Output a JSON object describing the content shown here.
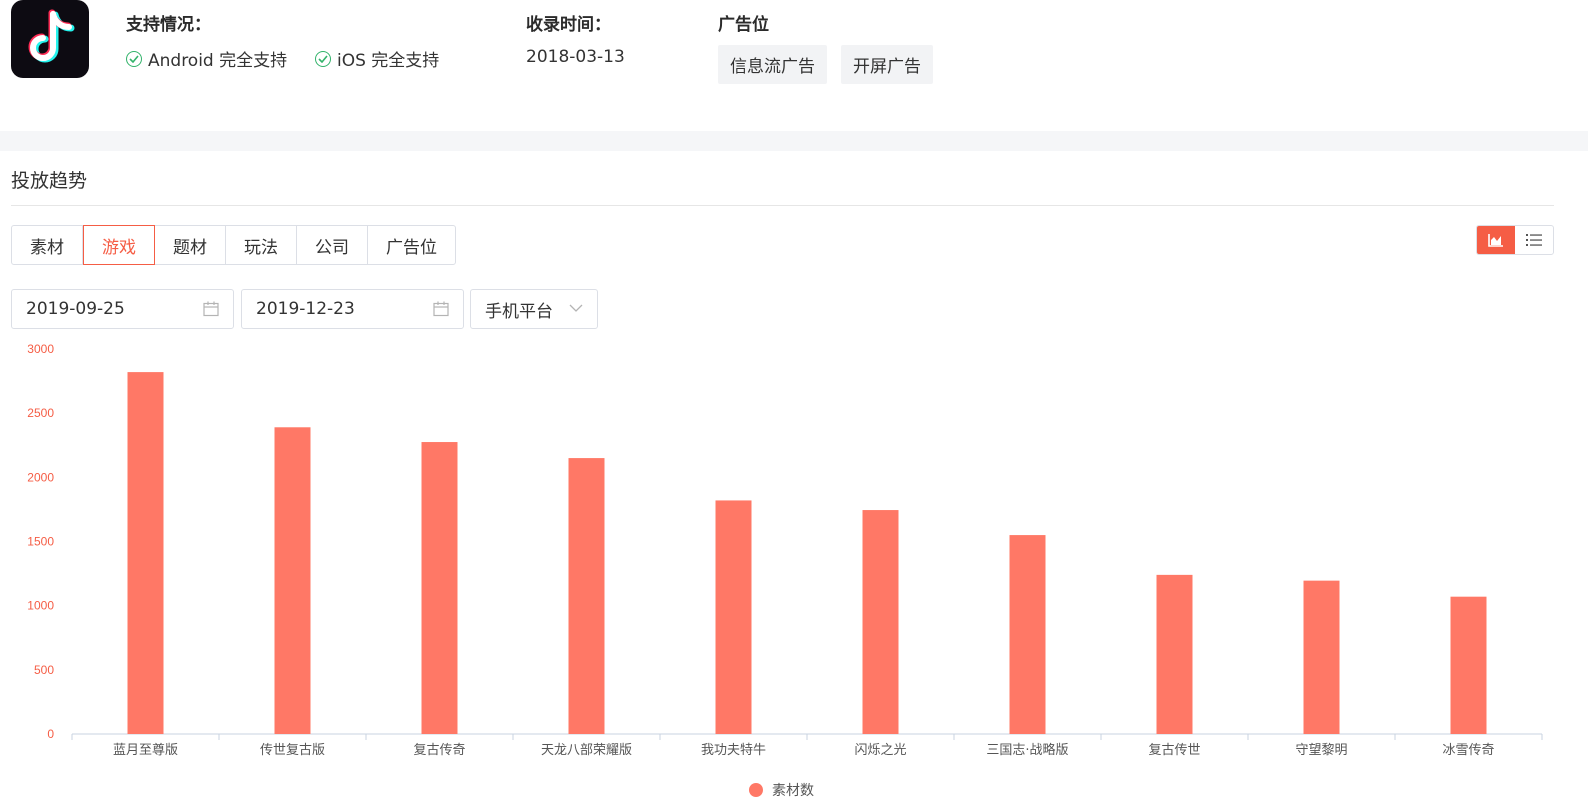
{
  "app": {
    "icon": "tiktok-logo-icon"
  },
  "support": {
    "label": "支持情况：",
    "items": [
      {
        "label": "Android 完全支持",
        "icon": "check-circle-icon"
      },
      {
        "label": "iOS 完全支持",
        "icon": "check-circle-icon"
      }
    ]
  },
  "record": {
    "label": "收录时间：",
    "date": "2018-03-13"
  },
  "ad_positions": {
    "label": "广告位",
    "tags": [
      "信息流广告",
      "开屏广告"
    ]
  },
  "section": {
    "title": "投放趋势"
  },
  "tabs": [
    {
      "label": "素材",
      "active": false
    },
    {
      "label": "游戏",
      "active": true
    },
    {
      "label": "题材",
      "active": false
    },
    {
      "label": "玩法",
      "active": false
    },
    {
      "label": "公司",
      "active": false
    },
    {
      "label": "广告位",
      "active": false
    }
  ],
  "view_toggle": {
    "chart_icon": "area-chart-icon",
    "list_icon": "list-icon",
    "active": "chart"
  },
  "filters": {
    "start_date": "2019-09-25",
    "end_date": "2019-12-23",
    "platform": "手机平台"
  },
  "colors": {
    "accent": "#f55d45",
    "bar": "#ff7866",
    "axis_label": "#f55d45",
    "tag_bg": "#f2f3f5"
  },
  "chart_data": {
    "type": "bar",
    "categories": [
      "蓝月至尊版",
      "传世复古版",
      "复古传奇",
      "天龙八部荣耀版",
      "我功夫特牛",
      "闪烁之光",
      "三国志·战略版",
      "复古传世",
      "守望黎明",
      "冰雪传奇"
    ],
    "series": [
      {
        "name": "素材数",
        "values": [
          2820,
          2390,
          2275,
          2150,
          1820,
          1745,
          1550,
          1240,
          1195,
          1070
        ]
      }
    ],
    "ylim": [
      0,
      3000
    ],
    "yticks": [
      0,
      500,
      1000,
      1500,
      2000,
      2500,
      3000
    ],
    "legend": "bottom-center",
    "grid": false
  }
}
